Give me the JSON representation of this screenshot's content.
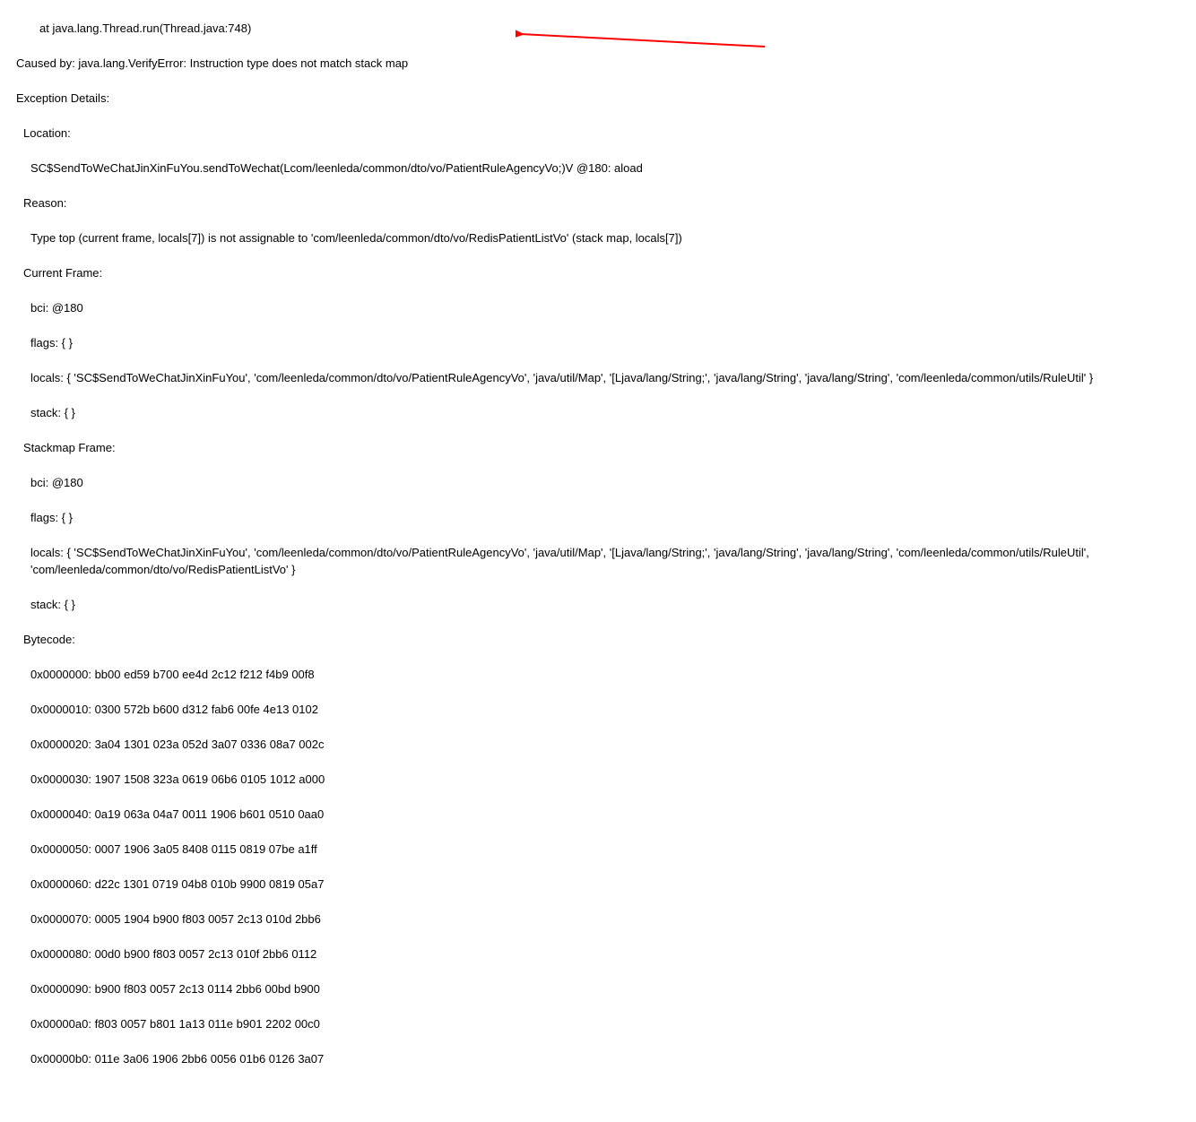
{
  "stack": {
    "thread_run": "at java.lang.Thread.run(Thread.java:748)",
    "caused_by": "Caused by: java.lang.VerifyError: Instruction type does not match stack map",
    "exception_details": "Exception Details:",
    "location_h": "Location:",
    "location_v": "SC$SendToWeChatJinXinFuYou.sendToWechat(Lcom/leenleda/common/dto/vo/PatientRuleAgencyVo;)V @180: aload",
    "reason_h": "Reason:",
    "reason_v": "Type top (current frame, locals[7]) is not assignable to 'com/leenleda/common/dto/vo/RedisPatientListVo' (stack map, locals[7])",
    "current_frame_h": "Current Frame:",
    "cf_bci": "bci: @180",
    "cf_flags": "flags: { }",
    "cf_locals": "locals: { 'SC$SendToWeChatJinXinFuYou', 'com/leenleda/common/dto/vo/PatientRuleAgencyVo', 'java/util/Map', '[Ljava/lang/String;', 'java/lang/String', 'java/lang/String', 'com/leenleda/common/utils/RuleUtil' }",
    "cf_stack": "stack: { }",
    "stackmap_frame_h": "Stackmap Frame:",
    "sm_bci": "bci: @180",
    "sm_flags": "flags: { }",
    "sm_locals": "locals: { 'SC$SendToWeChatJinXinFuYou', 'com/leenleda/common/dto/vo/PatientRuleAgencyVo', 'java/util/Map', '[Ljava/lang/String;', 'java/lang/String', 'java/lang/String', 'com/leenleda/common/utils/RuleUtil', 'com/leenleda/common/dto/vo/RedisPatientListVo' }",
    "sm_stack": "stack: { }",
    "bytecode_h": "Bytecode:",
    "bc00": "0x0000000: bb00 ed59 b700 ee4d 2c12 f212 f4b9 00f8",
    "bc01": "0x0000010: 0300 572b b600 d312 fab6 00fe 4e13 0102",
    "bc02": "0x0000020: 3a04 1301 023a 052d 3a07 0336 08a7 002c",
    "bc03": "0x0000030: 1907 1508 323a 0619 06b6 0105 1012 a000",
    "bc04": "0x0000040: 0a19 063a 04a7 0011 1906 b601 0510 0aa0",
    "bc05": "0x0000050: 0007 1906 3a05 8408 0115 0819 07be a1ff",
    "bc06": "0x0000060: d22c 1301 0719 04b8 010b 9900 0819 05a7",
    "bc07": "0x0000070: 0005 1904 b900 f803 0057 2c13 010d 2bb6",
    "bc08": "0x0000080: 00d0 b900 f803 0057 2c13 010f 2bb6 0112",
    "bc09": "0x0000090: b900 f803 0057 2c13 0114 2bb6 00bd b900",
    "bc10": "0x00000a0: f803 0057 b801 1a13 011e b901 2202 00c0",
    "bc11": "0x00000b0: 011e 3a06 1906 2bb6 0056 01b6 0126 3a07"
  },
  "arrow_color": "#ff0000"
}
